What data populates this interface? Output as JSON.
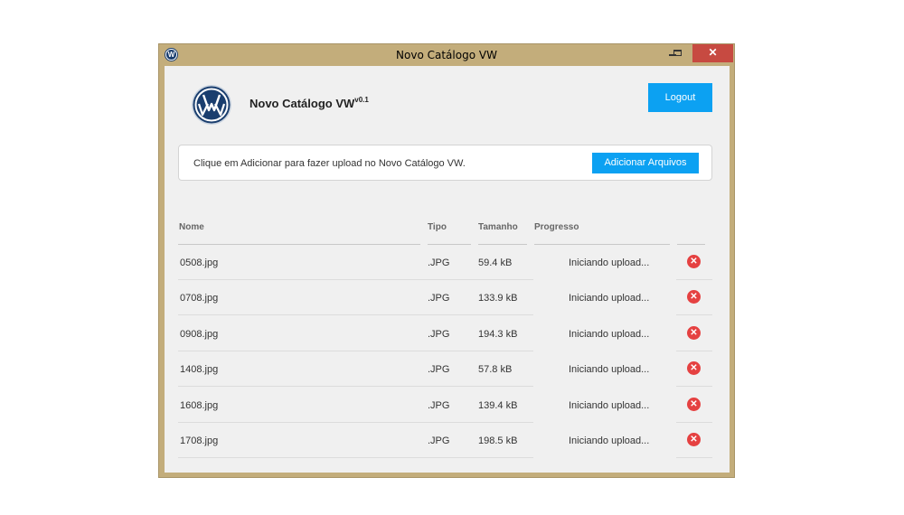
{
  "window": {
    "title": "Novo Catálogo VW",
    "icon": "vw-logo-icon",
    "controls": {
      "minimize": "minimize-icon",
      "maximize": "maximize-icon",
      "close": "✕"
    }
  },
  "header": {
    "logo_text": "VW",
    "app_name": "Novo Catálogo VW",
    "version": "v0.1",
    "logout_label": "Logout"
  },
  "upload": {
    "instruction": "Clique em Adicionar para fazer upload no Novo Catálogo VW.",
    "add_label": "Adicionar Arquivos"
  },
  "table": {
    "headers": {
      "name": "Nome",
      "type": "Tipo",
      "size": "Tamanho",
      "progress": "Progresso"
    },
    "rows": [
      {
        "name": "0508.jpg",
        "type": ".JPG",
        "size": "59.4 kB",
        "progress": "Iniciando upload..."
      },
      {
        "name": "0708.jpg",
        "type": ".JPG",
        "size": "133.9 kB",
        "progress": "Iniciando upload..."
      },
      {
        "name": "0908.jpg",
        "type": ".JPG",
        "size": "194.3 kB",
        "progress": "Iniciando upload..."
      },
      {
        "name": "1408.jpg",
        "type": ".JPG",
        "size": "57.8 kB",
        "progress": "Iniciando upload..."
      },
      {
        "name": "1608.jpg",
        "type": ".JPG",
        "size": "139.4 kB",
        "progress": "Iniciando upload..."
      },
      {
        "name": "1708.jpg",
        "type": ".JPG",
        "size": "198.5 kB",
        "progress": "Iniciando upload..."
      }
    ],
    "delete_glyph": "✕"
  },
  "colors": {
    "accent": "#0ca1f2",
    "window_frame": "#c3ad7b",
    "close_button": "#c74a41",
    "delete_icon": "#e54141",
    "vw_blue": "#1a3e6e"
  }
}
